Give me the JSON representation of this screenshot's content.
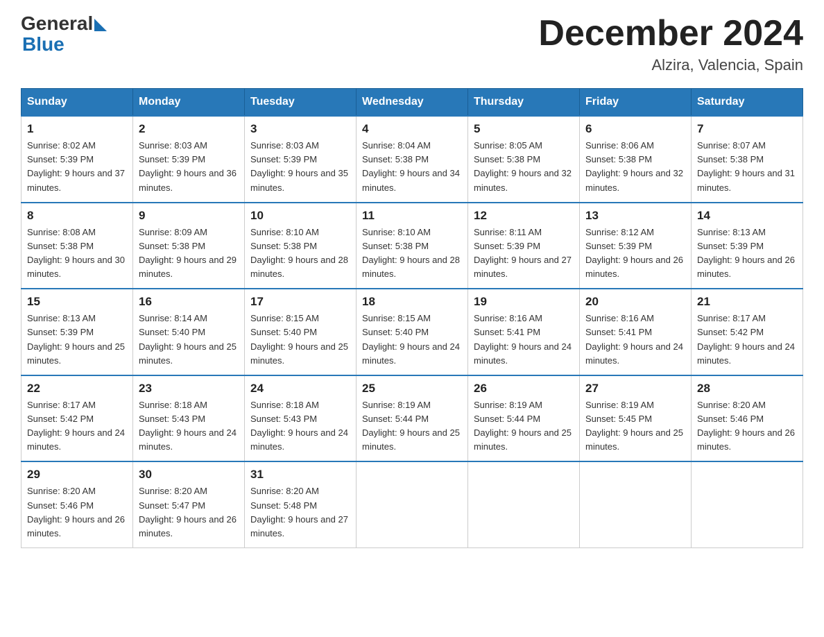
{
  "header": {
    "logo_general": "General",
    "logo_blue": "Blue",
    "month_title": "December 2024",
    "location": "Alzira, Valencia, Spain"
  },
  "days_of_week": [
    "Sunday",
    "Monday",
    "Tuesday",
    "Wednesday",
    "Thursday",
    "Friday",
    "Saturday"
  ],
  "weeks": [
    [
      {
        "day": "1",
        "sunrise": "8:02 AM",
        "sunset": "5:39 PM",
        "daylight": "9 hours and 37 minutes."
      },
      {
        "day": "2",
        "sunrise": "8:03 AM",
        "sunset": "5:39 PM",
        "daylight": "9 hours and 36 minutes."
      },
      {
        "day": "3",
        "sunrise": "8:03 AM",
        "sunset": "5:39 PM",
        "daylight": "9 hours and 35 minutes."
      },
      {
        "day": "4",
        "sunrise": "8:04 AM",
        "sunset": "5:38 PM",
        "daylight": "9 hours and 34 minutes."
      },
      {
        "day": "5",
        "sunrise": "8:05 AM",
        "sunset": "5:38 PM",
        "daylight": "9 hours and 32 minutes."
      },
      {
        "day": "6",
        "sunrise": "8:06 AM",
        "sunset": "5:38 PM",
        "daylight": "9 hours and 32 minutes."
      },
      {
        "day": "7",
        "sunrise": "8:07 AM",
        "sunset": "5:38 PM",
        "daylight": "9 hours and 31 minutes."
      }
    ],
    [
      {
        "day": "8",
        "sunrise": "8:08 AM",
        "sunset": "5:38 PM",
        "daylight": "9 hours and 30 minutes."
      },
      {
        "day": "9",
        "sunrise": "8:09 AM",
        "sunset": "5:38 PM",
        "daylight": "9 hours and 29 minutes."
      },
      {
        "day": "10",
        "sunrise": "8:10 AM",
        "sunset": "5:38 PM",
        "daylight": "9 hours and 28 minutes."
      },
      {
        "day": "11",
        "sunrise": "8:10 AM",
        "sunset": "5:38 PM",
        "daylight": "9 hours and 28 minutes."
      },
      {
        "day": "12",
        "sunrise": "8:11 AM",
        "sunset": "5:39 PM",
        "daylight": "9 hours and 27 minutes."
      },
      {
        "day": "13",
        "sunrise": "8:12 AM",
        "sunset": "5:39 PM",
        "daylight": "9 hours and 26 minutes."
      },
      {
        "day": "14",
        "sunrise": "8:13 AM",
        "sunset": "5:39 PM",
        "daylight": "9 hours and 26 minutes."
      }
    ],
    [
      {
        "day": "15",
        "sunrise": "8:13 AM",
        "sunset": "5:39 PM",
        "daylight": "9 hours and 25 minutes."
      },
      {
        "day": "16",
        "sunrise": "8:14 AM",
        "sunset": "5:40 PM",
        "daylight": "9 hours and 25 minutes."
      },
      {
        "day": "17",
        "sunrise": "8:15 AM",
        "sunset": "5:40 PM",
        "daylight": "9 hours and 25 minutes."
      },
      {
        "day": "18",
        "sunrise": "8:15 AM",
        "sunset": "5:40 PM",
        "daylight": "9 hours and 24 minutes."
      },
      {
        "day": "19",
        "sunrise": "8:16 AM",
        "sunset": "5:41 PM",
        "daylight": "9 hours and 24 minutes."
      },
      {
        "day": "20",
        "sunrise": "8:16 AM",
        "sunset": "5:41 PM",
        "daylight": "9 hours and 24 minutes."
      },
      {
        "day": "21",
        "sunrise": "8:17 AM",
        "sunset": "5:42 PM",
        "daylight": "9 hours and 24 minutes."
      }
    ],
    [
      {
        "day": "22",
        "sunrise": "8:17 AM",
        "sunset": "5:42 PM",
        "daylight": "9 hours and 24 minutes."
      },
      {
        "day": "23",
        "sunrise": "8:18 AM",
        "sunset": "5:43 PM",
        "daylight": "9 hours and 24 minutes."
      },
      {
        "day": "24",
        "sunrise": "8:18 AM",
        "sunset": "5:43 PM",
        "daylight": "9 hours and 24 minutes."
      },
      {
        "day": "25",
        "sunrise": "8:19 AM",
        "sunset": "5:44 PM",
        "daylight": "9 hours and 25 minutes."
      },
      {
        "day": "26",
        "sunrise": "8:19 AM",
        "sunset": "5:44 PM",
        "daylight": "9 hours and 25 minutes."
      },
      {
        "day": "27",
        "sunrise": "8:19 AM",
        "sunset": "5:45 PM",
        "daylight": "9 hours and 25 minutes."
      },
      {
        "day": "28",
        "sunrise": "8:20 AM",
        "sunset": "5:46 PM",
        "daylight": "9 hours and 26 minutes."
      }
    ],
    [
      {
        "day": "29",
        "sunrise": "8:20 AM",
        "sunset": "5:46 PM",
        "daylight": "9 hours and 26 minutes."
      },
      {
        "day": "30",
        "sunrise": "8:20 AM",
        "sunset": "5:47 PM",
        "daylight": "9 hours and 26 minutes."
      },
      {
        "day": "31",
        "sunrise": "8:20 AM",
        "sunset": "5:48 PM",
        "daylight": "9 hours and 27 minutes."
      },
      null,
      null,
      null,
      null
    ]
  ]
}
